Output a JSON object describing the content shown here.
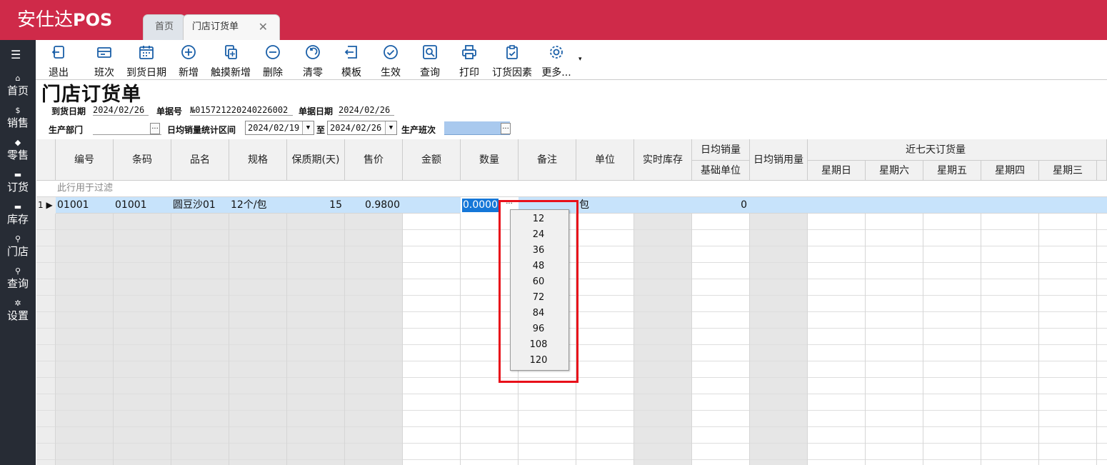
{
  "app": {
    "brand_prefix": "安仕达",
    "brand_suffix": "POS"
  },
  "tabs": [
    {
      "label": "首页"
    },
    {
      "label": "门店订货单",
      "close": "✕"
    }
  ],
  "sidebar": {
    "menu_icon": "☰",
    "items": [
      {
        "icon": "home-icon",
        "glyph": "⌂",
        "label": "首页"
      },
      {
        "icon": "dollar-icon",
        "glyph": "$",
        "label": "销售"
      },
      {
        "icon": "tag-icon",
        "glyph": "◆",
        "label": "零售"
      },
      {
        "icon": "cart-icon",
        "glyph": "▬",
        "label": "订货"
      },
      {
        "icon": "box-icon",
        "glyph": "▬",
        "label": "库存"
      },
      {
        "icon": "search-icon",
        "glyph": "⚲",
        "label": "门店"
      },
      {
        "icon": "search-icon",
        "glyph": "⚲",
        "label": "查询"
      },
      {
        "icon": "gear-icon",
        "glyph": "✲",
        "label": "设置"
      }
    ]
  },
  "toolbar": {
    "items": [
      {
        "icon": "exit-icon",
        "label": "退出"
      },
      {
        "icon": "shift-icon",
        "label": "班次"
      },
      {
        "icon": "calendar-icon",
        "label": "到货日期"
      },
      {
        "icon": "add-icon",
        "label": "新增"
      },
      {
        "icon": "touch-add-icon",
        "label": "触摸新增"
      },
      {
        "icon": "delete-icon",
        "label": "删除"
      },
      {
        "icon": "clear-icon",
        "label": "清零"
      },
      {
        "icon": "template-icon",
        "label": "模板"
      },
      {
        "icon": "activate-icon",
        "label": "生效"
      },
      {
        "icon": "query-icon",
        "label": "查询"
      },
      {
        "icon": "print-icon",
        "label": "打印"
      },
      {
        "icon": "order-factor-icon",
        "label": "订货因素"
      },
      {
        "icon": "more-icon",
        "label": "更多..."
      }
    ],
    "caret": "▾"
  },
  "form": {
    "title": "门店订货单",
    "arrival_label": "到货日期",
    "arrival_value": "2024/02/26",
    "docno_label": "单据号",
    "docno_value": "№015721220240226002",
    "docdate_label": "单据日期",
    "docdate_value": "2024/02/26",
    "dept_label": "生产部门",
    "dept_value": "",
    "range_label": "日均销量统计区间",
    "range_from": "2024/02/19",
    "range_to_label": "至",
    "range_to": "2024/02/26",
    "shift_label": "生产班次",
    "shift_value": "",
    "ellipsis": "...",
    "dropdown_arrow": "▼"
  },
  "grid": {
    "headers": {
      "code": "编号",
      "barcode": "条码",
      "name": "品名",
      "spec": "规格",
      "shelf_life": "保质期(天)",
      "price": "售价",
      "amount": "金额",
      "qty": "数量",
      "remark": "备注",
      "unit": "单位",
      "stock": "实时库存",
      "daily_sales": "日均销量",
      "base_unit": "基础单位",
      "daily_usage": "日均销用量",
      "last7": "近七天订货量",
      "days": [
        "星期日",
        "星期六",
        "星期五",
        "星期四",
        "星期三"
      ]
    },
    "filter_hint": "此行用于过滤",
    "row": {
      "index": "1",
      "pointer": "▶",
      "code": "01001",
      "barcode": "01001",
      "name": "圆豆沙01",
      "spec": "12个/包",
      "shelf_life": "15",
      "price": "0.9800",
      "amount": "",
      "qty": "0.0000",
      "qty_btn": "...",
      "remark": "",
      "unit": "包",
      "stock": "",
      "daily_sales": "0",
      "daily_usage": ""
    }
  },
  "qty_dropdown": {
    "options": [
      "12",
      "24",
      "36",
      "48",
      "60",
      "72",
      "84",
      "96",
      "108",
      "120"
    ]
  },
  "colors": {
    "topbar": "#cf2a49",
    "sidebar": "#272c35",
    "selection": "#c7e3fb",
    "highlight": "#e8101a"
  }
}
